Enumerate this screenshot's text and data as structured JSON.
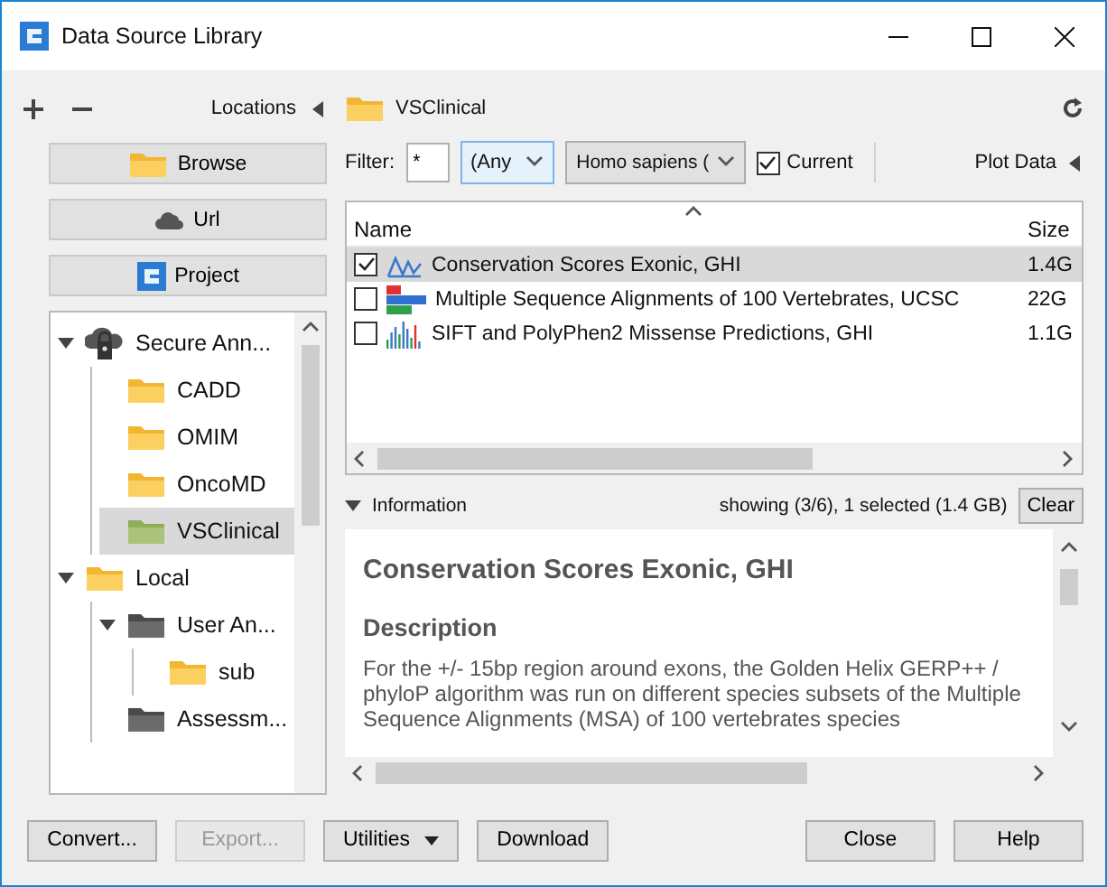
{
  "window": {
    "title": "Data Source Library"
  },
  "locations": {
    "label": "Locations"
  },
  "nav_buttons": [
    {
      "label": "Browse"
    },
    {
      "label": "Url"
    },
    {
      "label": "Project"
    }
  ],
  "tree": [
    {
      "label": "Secure Ann...",
      "kind": "secure",
      "expanded": true,
      "selected": false,
      "children": [
        {
          "label": "CADD",
          "kind": "folder",
          "selected": false
        },
        {
          "label": "OMIM",
          "kind": "folder",
          "selected": false
        },
        {
          "label": "OncoMD",
          "kind": "folder",
          "selected": false
        },
        {
          "label": "VSClinical",
          "kind": "folder",
          "selected": true
        }
      ]
    },
    {
      "label": "Local",
      "kind": "folder",
      "expanded": true,
      "selected": false,
      "children": [
        {
          "label": "User An...",
          "kind": "store",
          "expanded": true,
          "selected": false,
          "children": [
            {
              "label": "sub",
              "kind": "folder",
              "selected": false
            }
          ]
        },
        {
          "label": "Assessm...",
          "kind": "store",
          "selected": false
        }
      ]
    }
  ],
  "path": {
    "label": "VSClinical"
  },
  "filter": {
    "label": "Filter:",
    "value": "*",
    "type_select": "(Any",
    "species_select": "Homo sapiens (",
    "current": {
      "label": "Current",
      "checked": true
    },
    "plot_data": "Plot Data"
  },
  "files": {
    "columns": [
      "Name",
      "Size"
    ],
    "rows": [
      {
        "name": "Conservation Scores Exonic, GHI",
        "size": "1.4G",
        "checked": true,
        "selected": true,
        "kind": "wave"
      },
      {
        "name": "Multiple Sequence Alignments of 100 Vertebrates, UCSC",
        "size": "22G",
        "checked": false,
        "selected": false,
        "kind": "bars"
      },
      {
        "name": "SIFT and PolyPhen2 Missense Predictions, GHI",
        "size": "1.1G",
        "checked": false,
        "selected": false,
        "kind": "histogram"
      }
    ]
  },
  "information": {
    "label": "Information",
    "expanded": true,
    "status": "showing (3/6), 1 selected (1.4 GB)",
    "clear": "Clear",
    "title": "Conservation Scores Exonic, GHI",
    "heading": "Description",
    "text": "For the +/- 15bp region around exons, the Golden Helix GERP++ / phyloP algorithm was run on different species subsets of the Multiple Sequence Alignments (MSA) of 100 vertebrates species"
  },
  "buttons": [
    {
      "label": "Convert...",
      "kind": "plain",
      "disabled": false
    },
    {
      "label": "Export...",
      "kind": "plain",
      "disabled": true
    },
    {
      "label": "Utilities",
      "kind": "dropdown",
      "disabled": false
    },
    {
      "label": "Download",
      "kind": "plain",
      "disabled": false
    },
    {
      "label": "Close",
      "kind": "plain",
      "disabled": false
    },
    {
      "label": "Help",
      "kind": "plain",
      "disabled": false
    }
  ]
}
